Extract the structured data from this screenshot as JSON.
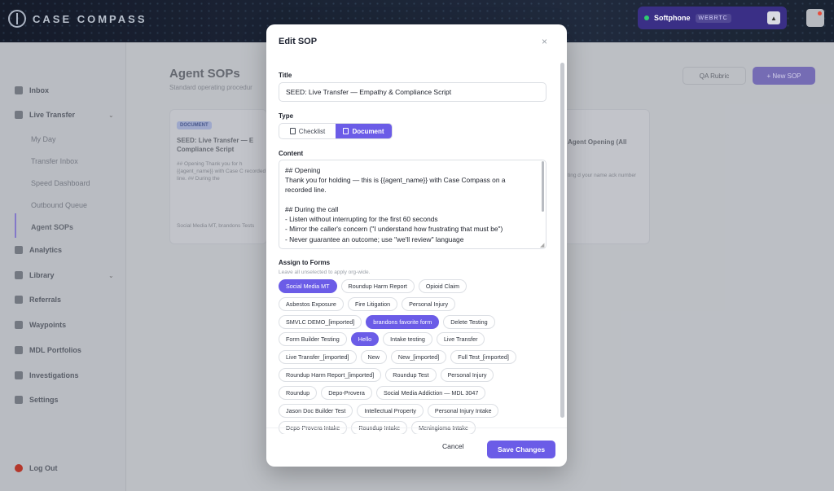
{
  "app": {
    "logo_text": "CASE COMPASS"
  },
  "softphone": {
    "title": "Softphone",
    "badge": "WEBRTC",
    "button_glyph": "▲"
  },
  "sidebar": {
    "items": [
      {
        "label": "Inbox"
      },
      {
        "label": "Live Transfer"
      },
      {
        "label": "My Day"
      },
      {
        "label": "Transfer Inbox"
      },
      {
        "label": "Speed Dashboard"
      },
      {
        "label": "Outbound Queue"
      },
      {
        "label": "Agent SOPs"
      },
      {
        "label": "Analytics"
      },
      {
        "label": "Library"
      },
      {
        "label": "Referrals"
      },
      {
        "label": "Waypoints"
      },
      {
        "label": "MDL Portfolios"
      },
      {
        "label": "Investigations"
      },
      {
        "label": "Settings"
      },
      {
        "label": "Log Out"
      }
    ]
  },
  "main": {
    "title": "Agent SOPs",
    "subtitle": "Standard operating procedur",
    "qa_button": "QA Rubric",
    "new_button": "+ New SOP",
    "card1": {
      "tag": "DOCUMENT",
      "title": "SEED: Live Transfer — E Compliance Script",
      "text": "## Opening Thank you for h {{agent_name}} with Case C recorded line. ## During the",
      "footer": "Social Media MT, brandons Tests"
    },
    "card2": {
      "title": "Agent Opening (All",
      "text": "ting d your name ack number"
    }
  },
  "modal": {
    "title": "Edit SOP",
    "close_glyph": "×",
    "title_label": "Title",
    "title_value": "SEED: Live Transfer — Empathy & Compliance Script",
    "type_label": "Type",
    "type_options": {
      "checklist": "Checklist",
      "document": "Document"
    },
    "selected_type": "Document",
    "content_label": "Content",
    "content_lines": [
      "## Opening",
      "Thank you for holding — this is {{agent_name}} with Case Compass on a",
      "recorded line.",
      "",
      "## During the call",
      "- Listen without interrupting for the first 60 seconds",
      "- Mirror the caller's concern (\"I understand how frustrating that must be\")",
      "- Never guarantee an outcome; use \"we'll review\" language"
    ],
    "forms_label": "Assign to Forms",
    "forms_hint": "Leave all unselected to apply org-wide.",
    "forms": [
      [
        "Social Media MT",
        "Roundup Harm Report",
        "Opioid Claim"
      ],
      [
        "Asbestos Exposure",
        "Fire Litigation",
        "Personal Injury"
      ],
      [
        "SMVLC DEMO_[imported]",
        "brandons favorite form",
        "Delete Testing"
      ],
      [
        "Form Builder Testing",
        "Hello",
        "Intake testing",
        "Live Transfer"
      ],
      [
        "Live Transfer_[imported]",
        "New",
        "New_[imported]",
        "Full Test_[imported]"
      ],
      [
        "Roundup Harm Report_[imported]",
        "Roundup Test",
        "Personal Injury"
      ],
      [
        "Roundup",
        "Depo-Provera",
        "Social Media Addiction — MDL 3047"
      ],
      [
        "Jason Doc Builder Test",
        "Intellectual Property",
        "Personal Injury Intake"
      ],
      [
        "Depo-Provera Intake",
        "Roundup Intake",
        "Meningioma Intake"
      ]
    ],
    "selected_forms": [
      "Social Media MT",
      "brandons favorite form",
      "Hello"
    ],
    "cancel_label": "Cancel",
    "save_label": "Save Changes"
  },
  "colors": {
    "accent": "#6b5ce7",
    "softphone_bg": "#3a2f86",
    "status_online": "#2ecc71"
  }
}
